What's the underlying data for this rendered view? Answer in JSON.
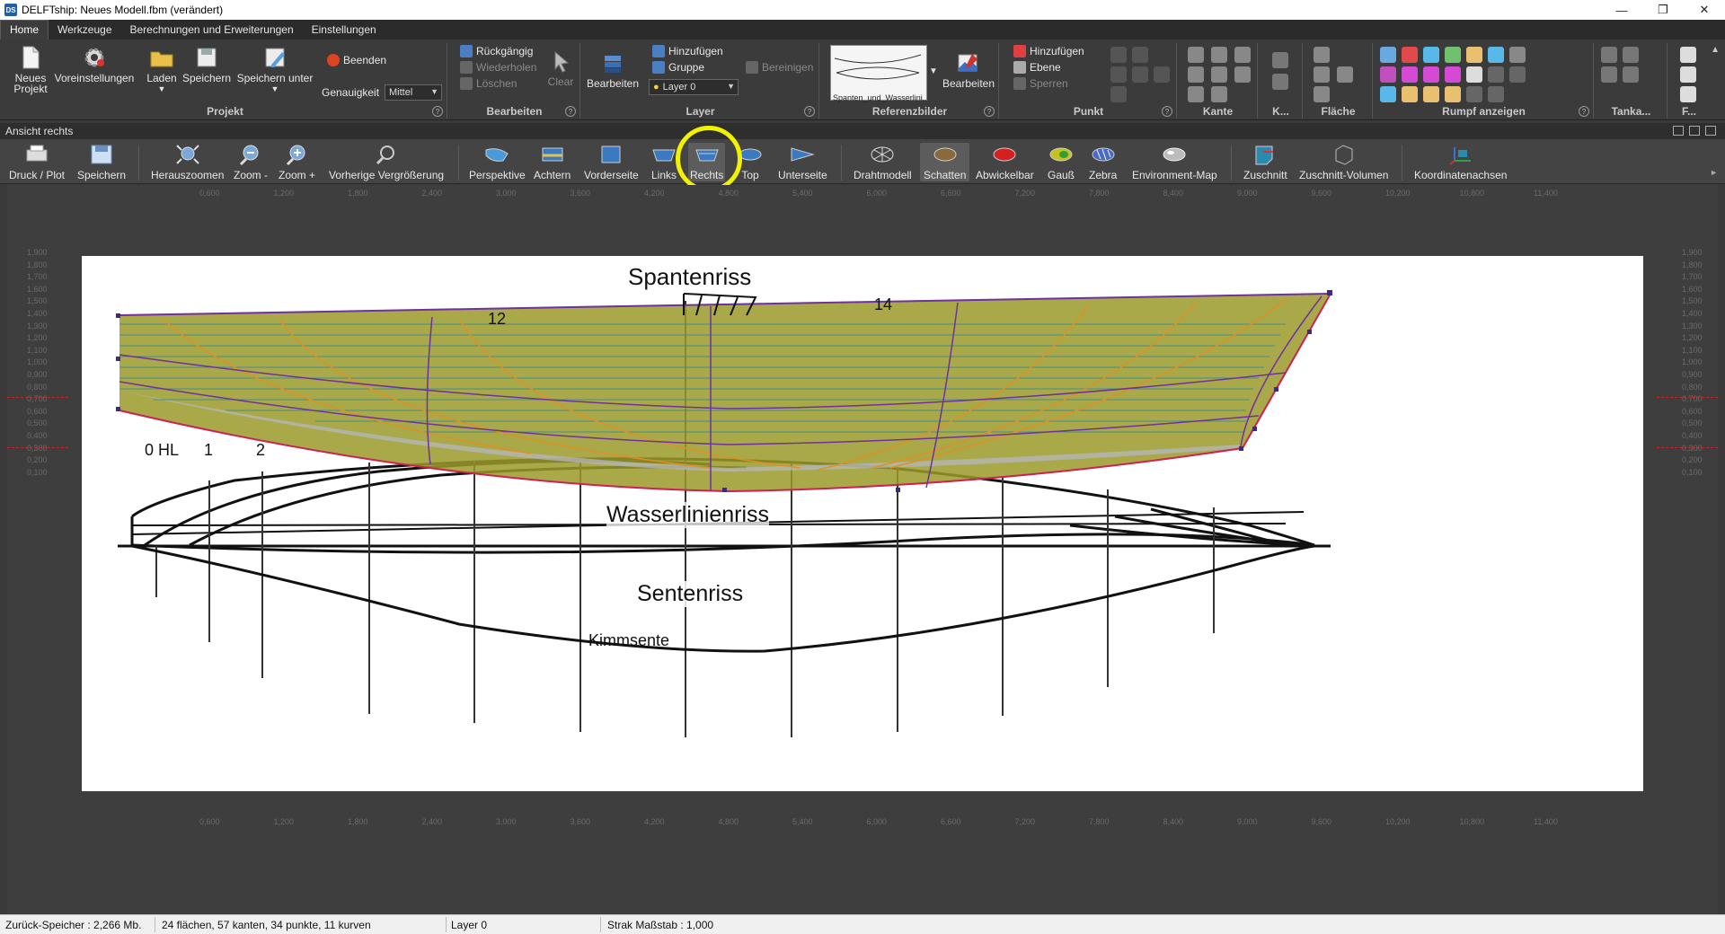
{
  "window": {
    "title": "DELFTship: Neues Modell.fbm (verändert)",
    "app_icon_text": "DS"
  },
  "menu": {
    "tabs": [
      "Home",
      "Werkzeuge",
      "Berechnungen und Erweiterungen",
      "Einstellungen"
    ],
    "active": "Home"
  },
  "ribbon": {
    "projekt": {
      "label": "Projekt",
      "neues_projekt": "Neues\nProjekt",
      "voreinstellungen": "Voreinstellungen",
      "laden": "Laden",
      "speichern": "Speichern",
      "speichern_unter": "Speichern unter",
      "beenden": "Beenden",
      "genauigkeit_label": "Genauigkeit",
      "genauigkeit_value": "Mittel"
    },
    "bearbeiten": {
      "label": "Bearbeiten",
      "rueckgaengig": "Rückgängig",
      "wiederholen": "Wiederholen",
      "loeschen": "Löschen",
      "clear": "Clear"
    },
    "layer": {
      "label": "Layer",
      "bearbeiten": "Bearbeiten",
      "hinzufuegen": "Hinzufügen",
      "gruppe": "Gruppe",
      "layer_value": "Layer 0",
      "bereinigen": "Bereinigen"
    },
    "referenzbilder": {
      "label": "Referenzbilder",
      "thumb_caption": "Spanten_und_Wasserlini...",
      "bearbeiten": "Bearbeiten"
    },
    "punkt": {
      "label": "Punkt",
      "hinzufuegen": "Hinzufügen",
      "ebene": "Ebene",
      "sperren": "Sperren"
    },
    "kante": {
      "label": "Kante"
    },
    "k": {
      "label": "K..."
    },
    "flaeche": {
      "label": "Fläche"
    },
    "rumpf": {
      "label": "Rumpf anzeigen"
    },
    "tanka": {
      "label": "Tanka..."
    },
    "f": {
      "label": "F..."
    }
  },
  "panel": {
    "title": "Ansicht rechts"
  },
  "viewbar": {
    "buttons": [
      {
        "id": "druck",
        "label": "Druck / Plot"
      },
      {
        "id": "speichern",
        "label": "Speichern"
      },
      {
        "id": "herauszoomen",
        "label": "Herauszoomen"
      },
      {
        "id": "zoom_minus",
        "label": "Zoom -"
      },
      {
        "id": "zoom_plus",
        "label": "Zoom +"
      },
      {
        "id": "vorherige",
        "label": "Vorherige Vergrößerung"
      },
      {
        "id": "perspektive",
        "label": "Perspektive"
      },
      {
        "id": "achtern",
        "label": "Achtern"
      },
      {
        "id": "vorderseite",
        "label": "Vorderseite"
      },
      {
        "id": "links",
        "label": "Links"
      },
      {
        "id": "rechts",
        "label": "Rechts"
      },
      {
        "id": "top",
        "label": "Top"
      },
      {
        "id": "unterseite",
        "label": "Unterseite"
      },
      {
        "id": "drahtmodell",
        "label": "Drahtmodell"
      },
      {
        "id": "schatten",
        "label": "Schatten"
      },
      {
        "id": "abwickelbar",
        "label": "Abwickelbar"
      },
      {
        "id": "gauss",
        "label": "Gauß"
      },
      {
        "id": "zebra",
        "label": "Zebra"
      },
      {
        "id": "envmap",
        "label": "Environment-Map"
      },
      {
        "id": "zuschnitt",
        "label": "Zuschnitt"
      },
      {
        "id": "zuschnitt_vol",
        "label": "Zuschnitt-Volumen"
      },
      {
        "id": "koordinaten",
        "label": "Koordinatenachsen"
      }
    ],
    "active": [
      "rechts",
      "schatten"
    ]
  },
  "drawing": {
    "title_spantenriss": "Spantenriss",
    "title_wasserlinienriss": "Wasserlinienriss",
    "title_sentenriss": "Sentenriss",
    "label_kimmsente": "Kimmsente",
    "station_labels": [
      "0 HL",
      "1",
      "2",
      "12",
      "14"
    ],
    "ruler_top": [
      "0,600",
      "1,200",
      "1,800",
      "2,400",
      "3,000",
      "3,600",
      "4,200",
      "4,800",
      "5,400",
      "6,000",
      "6,600",
      "7,200",
      "7,800",
      "8,400",
      "9,000",
      "9,600",
      "10,200",
      "10,800",
      "11,400"
    ],
    "ruler_left": [
      "1,900",
      "1,800",
      "1,700",
      "1,600",
      "1,500",
      "1,400",
      "1,300",
      "1,200",
      "1,100",
      "1,000",
      "0,900",
      "0,800",
      "0,700",
      "0,600",
      "0,500",
      "0,400",
      "0,300",
      "0,200",
      "0,100"
    ]
  },
  "status": {
    "memory": "Zurück-Speicher : 2,266 Mb.",
    "counts": "24 flächen, 57 kanten, 34 punkte, 11 kurven",
    "layer": "Layer 0",
    "strak": "Strak Maßstab : 1,000"
  },
  "colors": {
    "hull_fill": "#9a9a2a",
    "highlight_ring": "#f2f200",
    "chrome_dark": "#3b3b3b"
  }
}
